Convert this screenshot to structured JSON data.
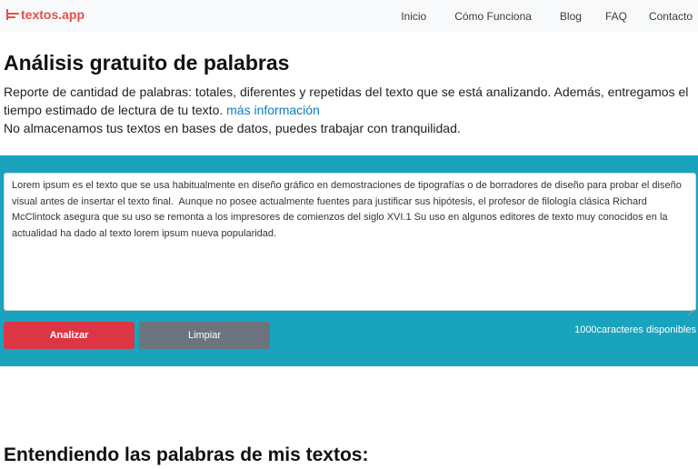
{
  "navbar": {
    "brand": "textos.app",
    "brand_icon": "notes-icon",
    "links": [
      "Inicio",
      "Cómo Funciona",
      "Blog",
      "FAQ",
      "Contacto"
    ]
  },
  "hero": {
    "title": "Análisis gratuito de palabras",
    "description": "Reporte de cantidad de palabras: totales, diferentes y repetidas del texto que se está analizando. Además, entregamos el tiempo estimado de lectura de tu texto.",
    "more_link": "más información",
    "privacy_note": "No almacenamos tus textos en bases de datos, puedes trabajar con tranquilidad."
  },
  "editor": {
    "text": "Lorem ipsum es el texto que se usa habitualmente en diseño gráfico en demostraciones de tipografías o de borradores de diseño para probar el diseño visual antes de insertar el texto final.  Aunque no posee actualmente fuentes para justificar sus hipótesis, el profesor de filología clásica Richard McClintock asegura que su uso se remonta a los impresores de comienzos del siglo XVI.1 Su uso en algunos editores de texto muy conocidos en la actualidad ha dado al texto lorem ipsum nueva popularidad.",
    "analyze_label": "Analizar",
    "clear_label": "Limpiar",
    "remaining": "1000caracteres disponibles"
  },
  "section": {
    "title": "Entendiendo las palabras de mis textos:"
  },
  "colors": {
    "brand": "#e0524e",
    "band": "#1aa3bd",
    "analyze": "#dc3545",
    "clear": "#6c757d",
    "link": "#0d7bc4"
  }
}
